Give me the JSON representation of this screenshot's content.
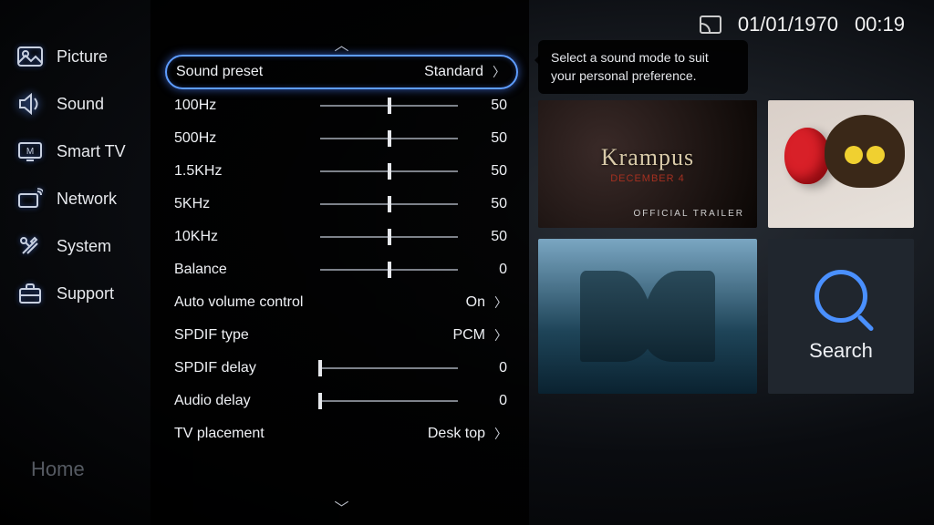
{
  "status": {
    "date": "01/01/1970",
    "time": "00:19"
  },
  "sidebar": {
    "items": [
      {
        "label": "Picture"
      },
      {
        "label": "Sound"
      },
      {
        "label": "Smart TV"
      },
      {
        "label": "Network"
      },
      {
        "label": "System"
      },
      {
        "label": "Support"
      }
    ],
    "home": "Home"
  },
  "tooltip": "Select a sound mode to suit your personal preference.",
  "settings": {
    "sound_preset": {
      "label": "Sound preset",
      "value": "Standard"
    },
    "eq": [
      {
        "label": "100Hz",
        "value": 50,
        "pos": 50
      },
      {
        "label": "500Hz",
        "value": 50,
        "pos": 50
      },
      {
        "label": "1.5KHz",
        "value": 50,
        "pos": 50
      },
      {
        "label": "5KHz",
        "value": 50,
        "pos": 50
      },
      {
        "label": "10KHz",
        "value": 50,
        "pos": 50
      }
    ],
    "balance": {
      "label": "Balance",
      "value": 0,
      "pos": 50
    },
    "avc": {
      "label": "Auto volume control",
      "value": "On"
    },
    "spdif_type": {
      "label": "SPDIF type",
      "value": "PCM"
    },
    "spdif_delay": {
      "label": "SPDIF delay",
      "value": 0,
      "pos": 0
    },
    "audio_delay": {
      "label": "Audio delay",
      "value": 0,
      "pos": 0
    },
    "tv_place": {
      "label": "TV placement",
      "value": "Desk top"
    }
  },
  "tiles": {
    "krampus": {
      "title": "Krampus",
      "subtitle": "DECEMBER 4",
      "tag": "OFFICIAL TRAILER"
    },
    "search": {
      "label": "Search"
    }
  }
}
